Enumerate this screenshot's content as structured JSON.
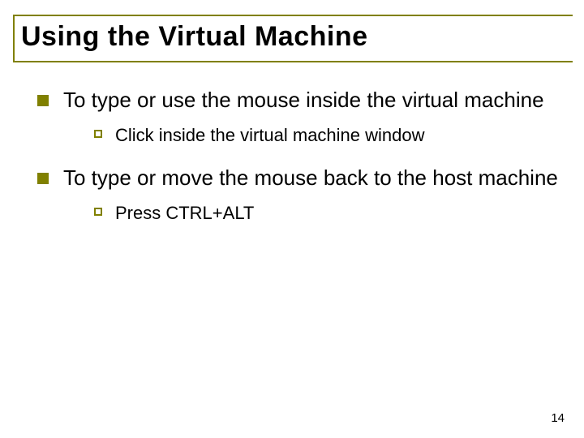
{
  "slide": {
    "title": "Using the Virtual Machine",
    "bullets": [
      {
        "text": "To type or use the mouse inside the virtual machine",
        "sub": [
          "Click inside the virtual machine window"
        ]
      },
      {
        "text": "To type or move the mouse back to the host machine",
        "sub": [
          "Press CTRL+ALT"
        ]
      }
    ],
    "page_number": "14"
  }
}
